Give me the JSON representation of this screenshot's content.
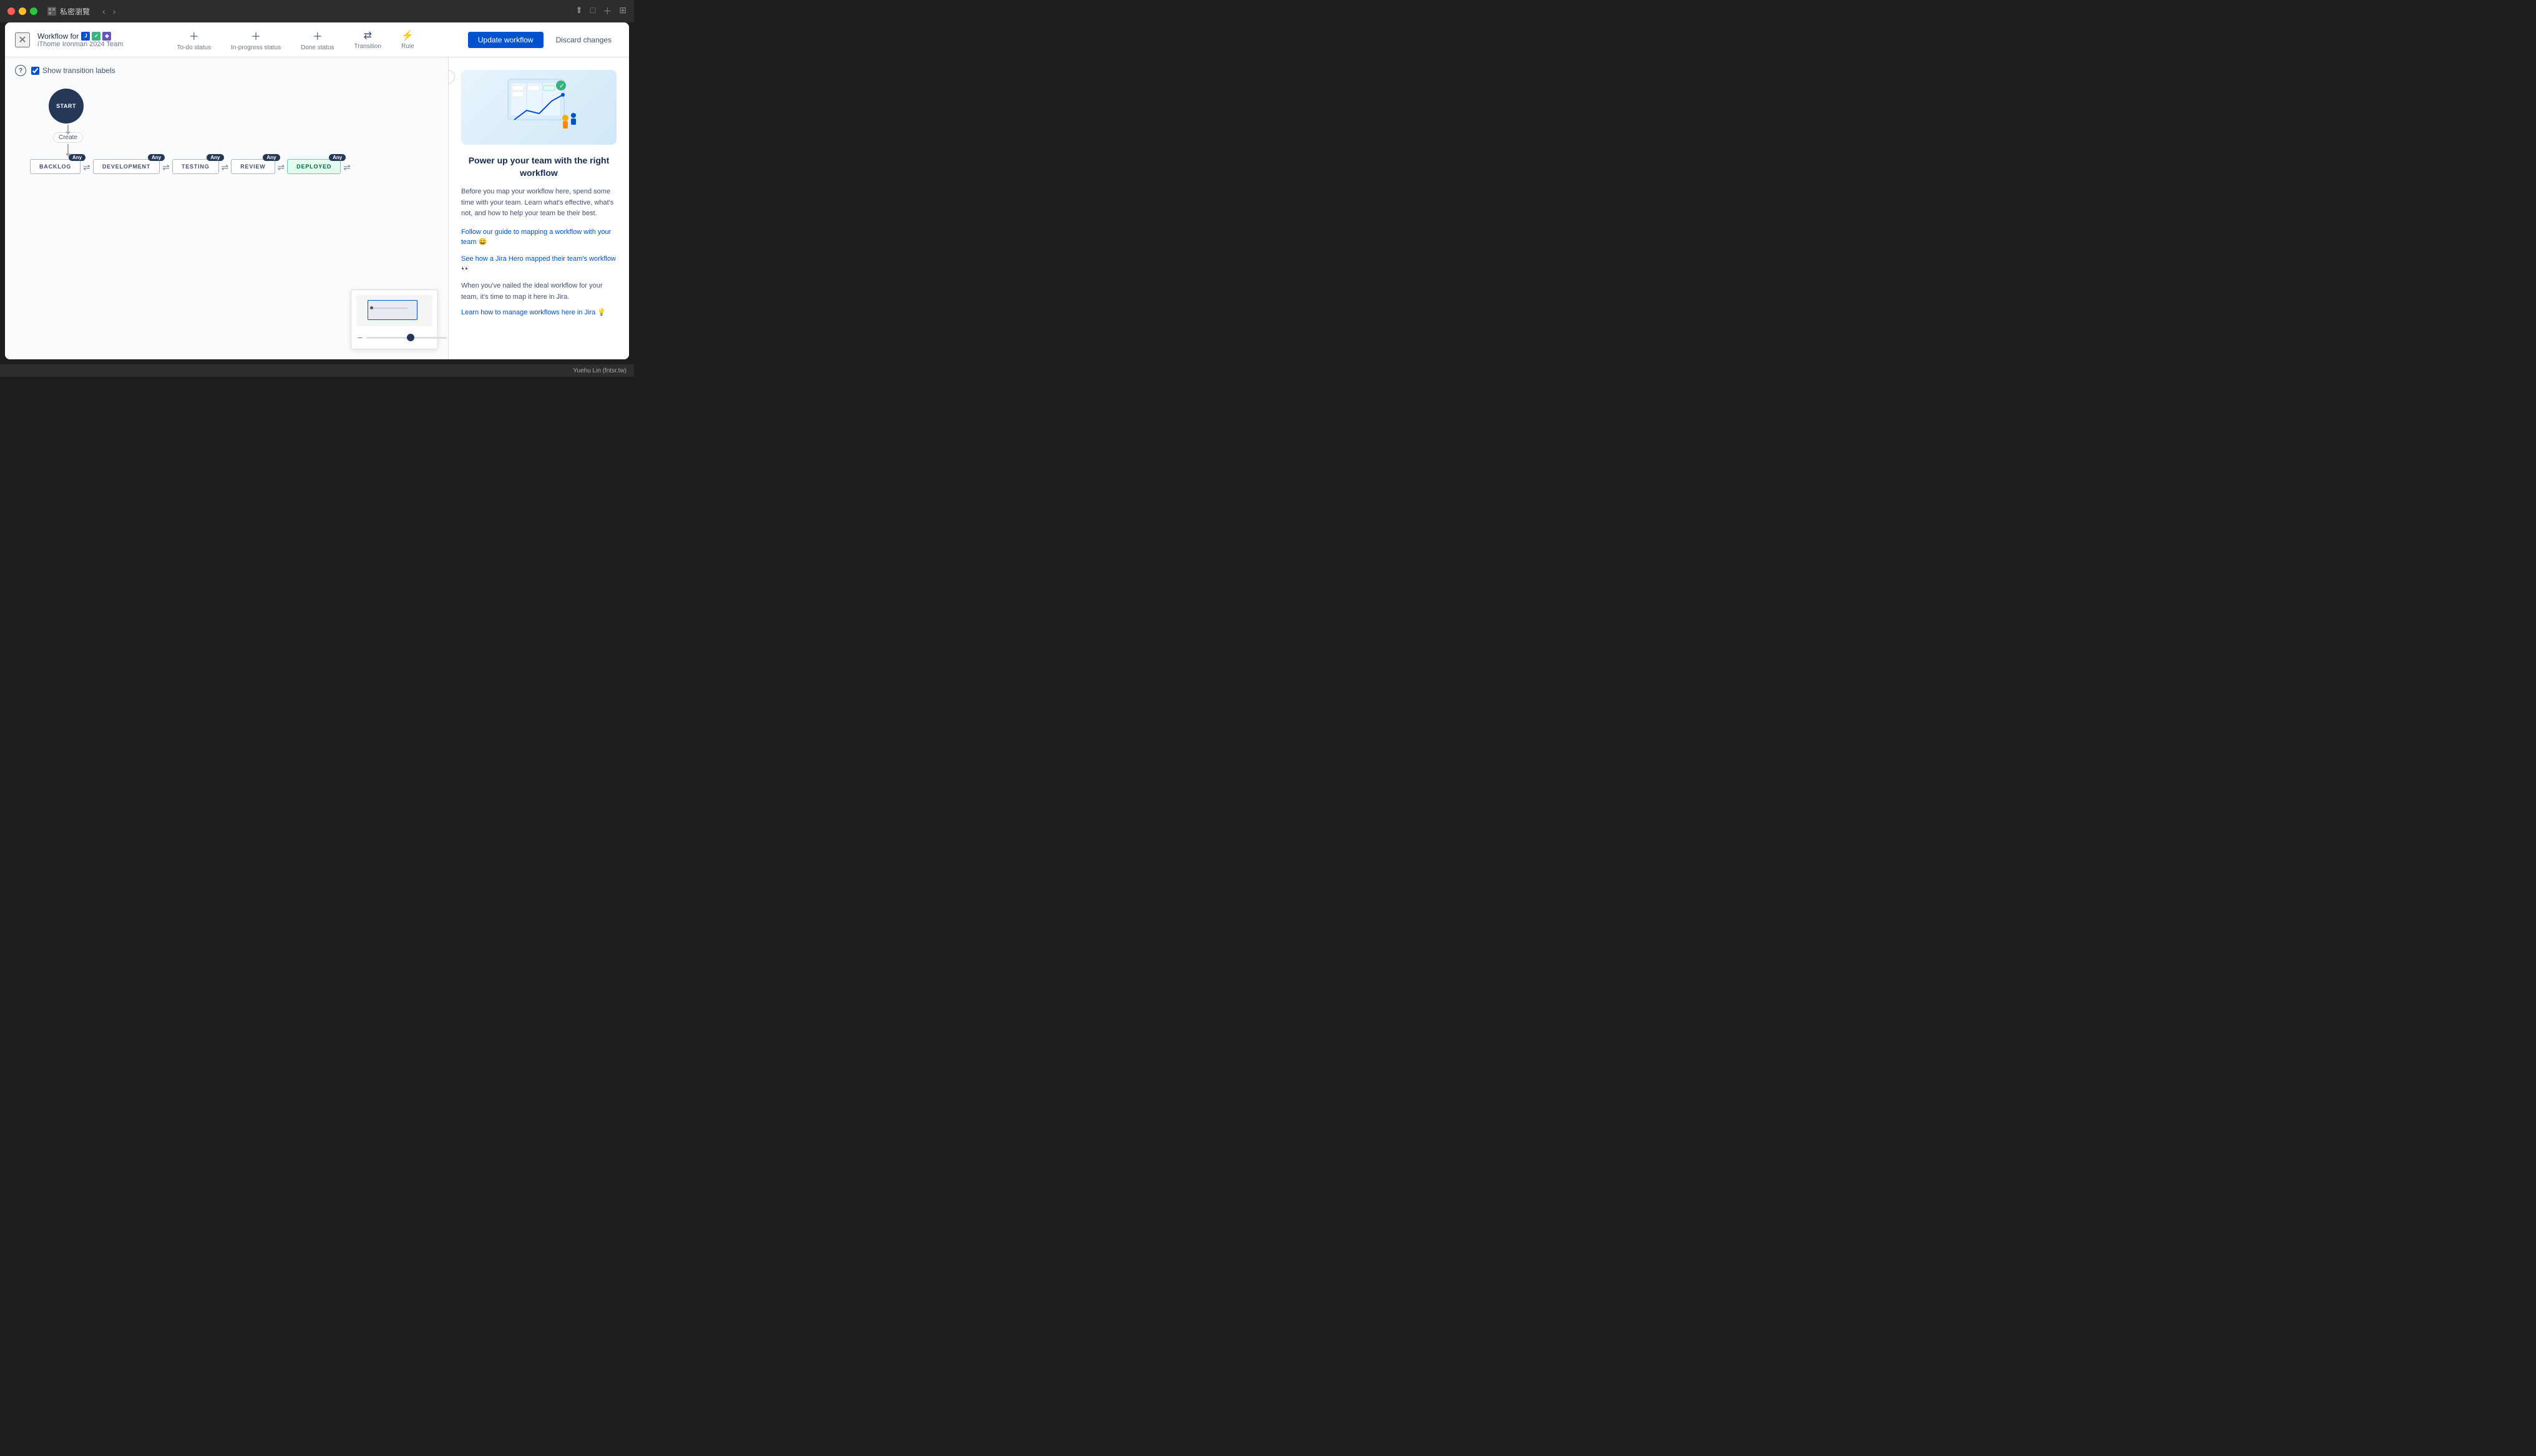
{
  "titlebar": {
    "window_title": "私密瀏覽",
    "tl_red": "red",
    "tl_yellow": "yellow",
    "tl_green": "green"
  },
  "header": {
    "workflow_for_label": "Workflow for",
    "team_name": "iThome Ironman 2024 Team",
    "close_icon": "✕",
    "actions": [
      {
        "icon": "+",
        "label": "To-do status"
      },
      {
        "icon": "+",
        "label": "In-progress status"
      },
      {
        "icon": "+",
        "label": "Done status"
      },
      {
        "icon": "⇄",
        "label": "Transition"
      },
      {
        "icon": "⚡",
        "label": "Rule"
      }
    ],
    "update_btn": "Update workflow",
    "discard_btn": "Discard changes"
  },
  "canvas": {
    "help_tooltip": "?",
    "show_transition_label": "Show transition labels",
    "start_label": "START",
    "create_label": "Create",
    "statuses": [
      {
        "id": "backlog",
        "label": "BACKLOG",
        "any": "Any",
        "deployed": false
      },
      {
        "id": "development",
        "label": "DEVELOPMENT",
        "any": "Any",
        "deployed": false
      },
      {
        "id": "testing",
        "label": "TESTING",
        "any": "Any",
        "deployed": false
      },
      {
        "id": "review",
        "label": "REVIEW",
        "any": "Any",
        "deployed": false
      },
      {
        "id": "deployed",
        "label": "DEPLOYED",
        "any": "Any",
        "deployed": true
      }
    ]
  },
  "sidebar": {
    "toggle_icon": "›",
    "title": "Power up your team with the right workflow",
    "body": "Before you map your workflow here, spend some time with your team. Learn what's effective, what's not, and how to help your team be their best.",
    "link1": "Follow our guide to mapping a workflow with your team 😄",
    "link2": "See how a Jira Hero mapped their team's workflow 👀",
    "footer": "When you've nailed the ideal workflow for your team, it's time to map it here in Jira.",
    "link3": "Learn how to manage workflows here in Jira 💡"
  },
  "footer": {
    "user": "Yuehu Lin (fntsr.tw)"
  }
}
